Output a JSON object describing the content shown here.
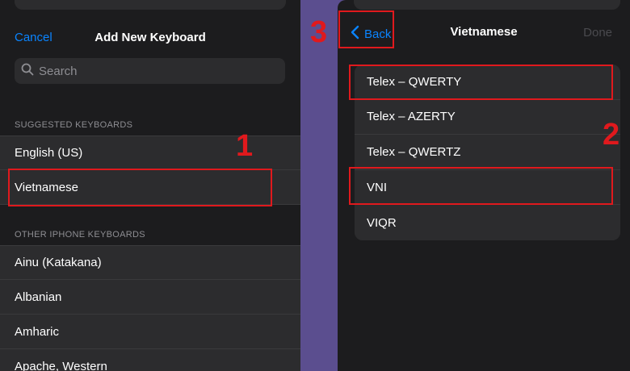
{
  "left_panel": {
    "cancel_label": "Cancel",
    "title": "Add New Keyboard",
    "search_placeholder": "Search",
    "suggested_header": "SUGGESTED KEYBOARDS",
    "suggested_items": [
      "English (US)",
      "Vietnamese"
    ],
    "other_header": "OTHER IPHONE KEYBOARDS",
    "other_items": [
      "Ainu (Katakana)",
      "Albanian",
      "Amharic",
      "Apache, Western"
    ]
  },
  "right_panel": {
    "back_label": "Back",
    "title": "Vietnamese",
    "done_label": "Done",
    "items": [
      "Telex – QWERTY",
      "Telex – AZERTY",
      "Telex – QWERTZ",
      "VNI",
      "VIQR"
    ]
  },
  "step_badges": [
    "1",
    "2",
    "3"
  ],
  "colors": {
    "accent_blue": "#0a84ff",
    "highlight_red": "#e0191d",
    "divider_purple": "#5b4e8f"
  },
  "icons": {
    "search": "search-icon",
    "back": "chevron-left-icon"
  }
}
